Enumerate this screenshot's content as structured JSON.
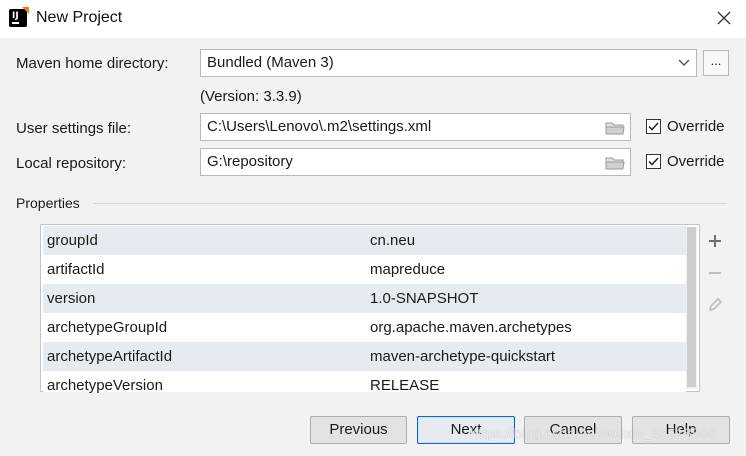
{
  "window": {
    "title": "New Project",
    "icon": "intellij-idea-icon",
    "icon_text": "IJ"
  },
  "form": {
    "maven_home": {
      "label": "Maven home directory:",
      "value": "Bundled (Maven 3)",
      "browse_label": "..."
    },
    "version_text": "(Version: 3.3.9)",
    "user_settings": {
      "label": "User settings file:",
      "value": "C:\\Users\\Lenovo\\.m2\\settings.xml",
      "override_label": "Override",
      "override_checked": true
    },
    "local_repo": {
      "label": "Local repository:",
      "value": "G:\\repository",
      "override_label": "Override",
      "override_checked": true
    }
  },
  "properties": {
    "title": "Properties",
    "rows": [
      {
        "key": "groupId",
        "value": "cn.neu"
      },
      {
        "key": "artifactId",
        "value": "mapreduce"
      },
      {
        "key": "version",
        "value": "1.0-SNAPSHOT"
      },
      {
        "key": "archetypeGroupId",
        "value": "org.apache.maven.archetypes"
      },
      {
        "key": "archetypeArtifactId",
        "value": "maven-archetype-quickstart"
      },
      {
        "key": "archetypeVersion",
        "value": "RELEASE"
      }
    ],
    "tools": [
      "plus-icon",
      "minus-icon",
      "pencil-icon"
    ]
  },
  "buttons": {
    "previous": "Previous",
    "next": "Next",
    "cancel": "Cancel",
    "help": "Help"
  },
  "watermark": "https://blog.csdn.net/weixin_43518880",
  "colors": {
    "row_alt": "#e6ebf1",
    "primary_border": "#0a64d6",
    "background": "#f2f2f2"
  }
}
